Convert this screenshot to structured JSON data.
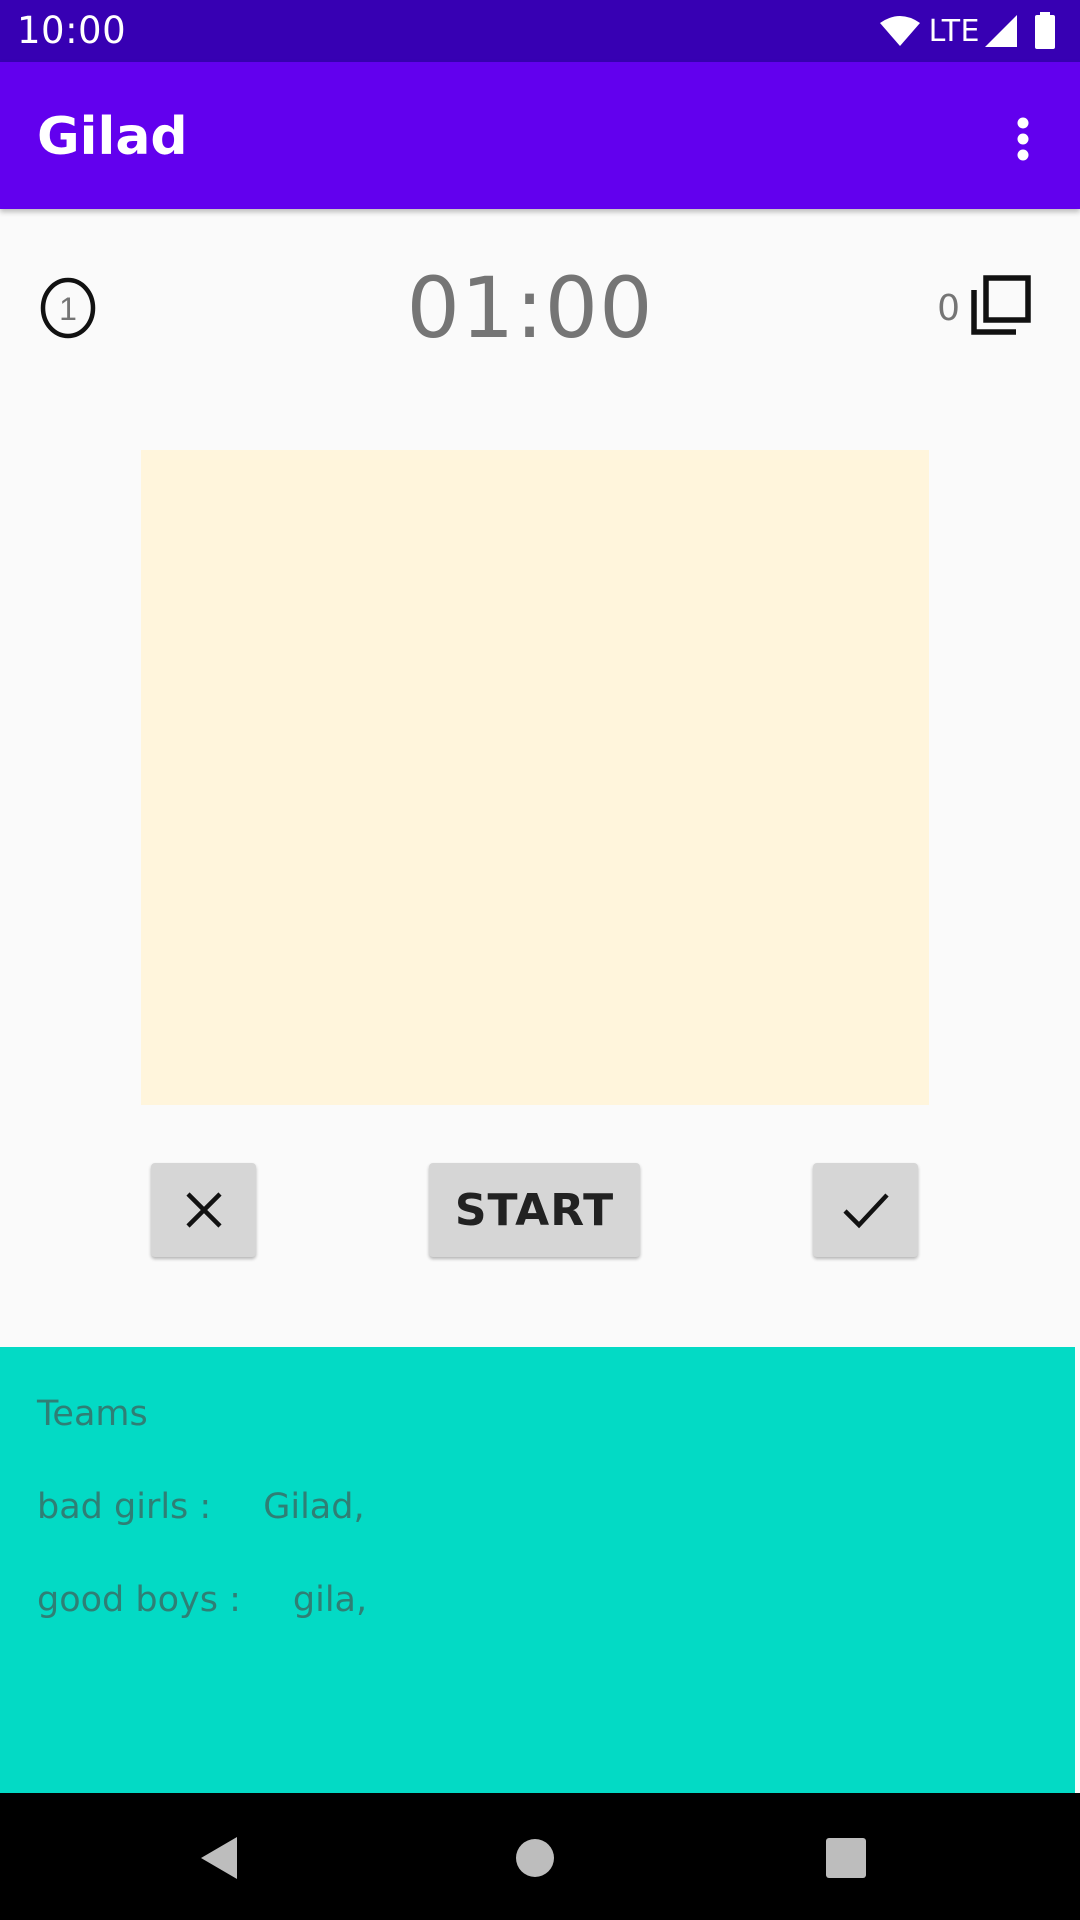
{
  "status_bar": {
    "time": "10:00",
    "network": "LTE",
    "icons": [
      "wifi-icon",
      "cell-signal-icon",
      "battery-icon"
    ]
  },
  "app_bar": {
    "title": "Gilad",
    "menu_icon": "more-vert-icon"
  },
  "game": {
    "round_number": "1",
    "timer": "01:00",
    "card_count": "0",
    "cards_icon": "cards-stack-icon",
    "card_color": "#fff5dc"
  },
  "controls": {
    "skip_icon": "close-icon",
    "start_label": "START",
    "correct_icon": "check-icon"
  },
  "teams": {
    "title": "Teams",
    "list": [
      {
        "name": "bad girls :",
        "members": "Gilad,"
      },
      {
        "name": "good boys :",
        "members": "gila,"
      }
    ],
    "panel_color": "#03dac5"
  },
  "colors": {
    "status_bar": "#3700b3",
    "primary": "#6200ee",
    "button": "#d6d6d6"
  },
  "nav_bar": {
    "icons": [
      "back-icon",
      "home-icon",
      "recents-icon"
    ]
  }
}
